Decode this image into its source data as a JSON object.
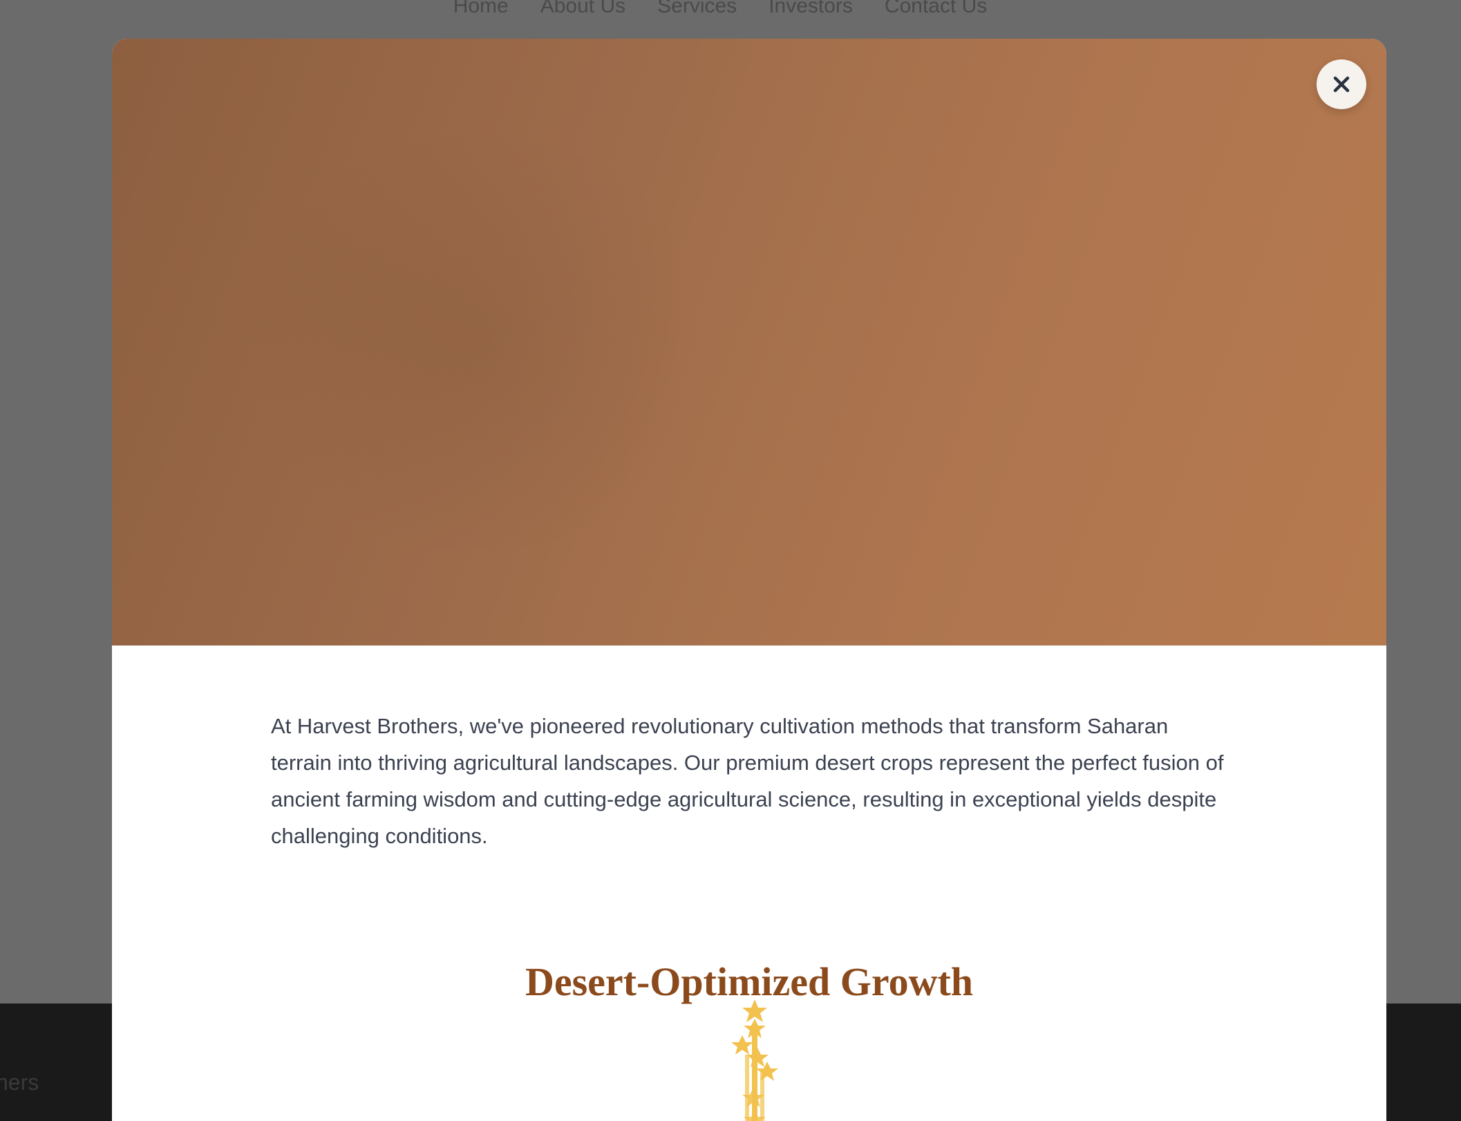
{
  "background_nav": {
    "items": [
      "Home",
      "About Us",
      "Services",
      "Investors",
      "Contact Us"
    ]
  },
  "background_footer": {
    "partial_text": "hers"
  },
  "modal": {
    "close_label": "×",
    "intro_text": "At Harvest Brothers, we've pioneered revolutionary cultivation methods that transform Saharan terrain into thriving agricultural landscapes. Our premium desert crops represent the perfect fusion of ancient farming wisdom and cutting-edge agricultural science, resulting in exceptional yields despite challenging conditions.",
    "section_title": "Desert-Optimized Growth"
  },
  "colors": {
    "overlay": "#6b6b6b",
    "hero_gradient_start": "#8d5f40",
    "hero_gradient_end": "#b77a4f",
    "title": "#8b4a1c",
    "body_text": "#3b4150",
    "plant": "#f2c14e"
  },
  "icons": {
    "close": "close-icon",
    "plant": "wheat-plant-icon"
  }
}
